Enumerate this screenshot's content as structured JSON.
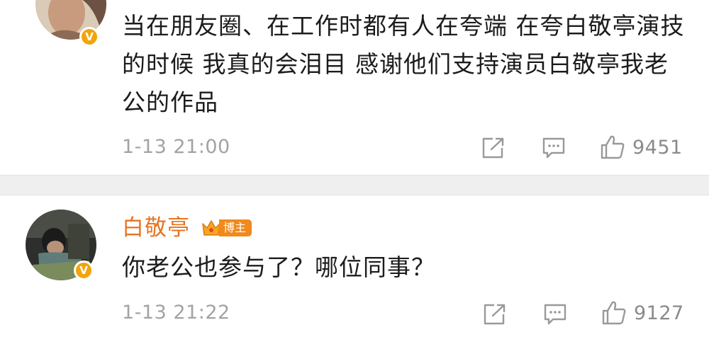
{
  "comments": [
    {
      "text": "当在朋友圈、在工作时都有人在夸端  在夸白敬亭演技的时候  我真的会泪目  感谢他们支持演员白敬亭我老公的作品",
      "timestamp": "1-13 21:00",
      "likes": "9451",
      "verified_badge": "V"
    },
    {
      "username": "白敬亭",
      "blogger_tag": "博主",
      "text": "你老公也参与了？哪位同事？",
      "timestamp": "1-13 21:22",
      "likes": "9127",
      "verified_badge": "V"
    }
  ],
  "icons": {
    "share": "share-icon",
    "comment": "comment-icon",
    "like": "thumbs-up-icon"
  },
  "colors": {
    "username": "#e8731f",
    "badge": "#f2a40c",
    "timestamp": "#a3a3a3",
    "separator": "#efefef"
  }
}
